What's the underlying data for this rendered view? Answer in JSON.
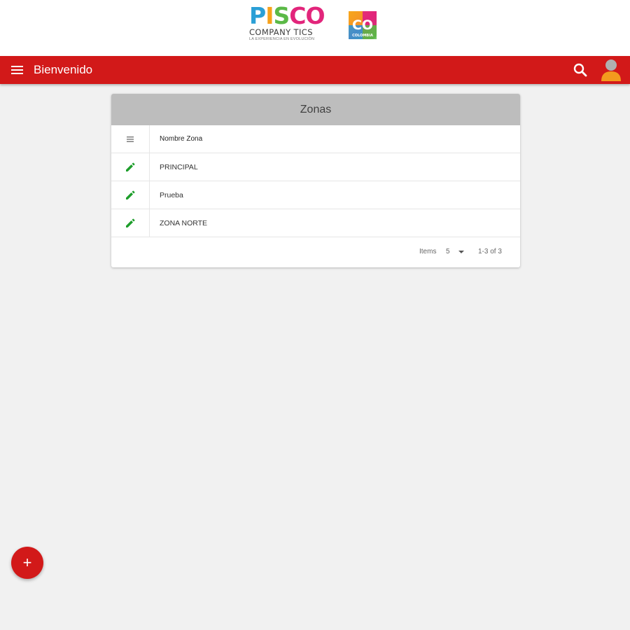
{
  "brand": {
    "logo_text_letters": [
      "P",
      "I",
      "S",
      "C",
      "O"
    ],
    "logo_subtitle": "COMPANY TICS",
    "logo_tagline": "LA EXPERIENCIA EN EVOLUCIÓN",
    "badge_text": "CO",
    "badge_caption": "COLOMBIA"
  },
  "appbar": {
    "title": "Bienvenido",
    "color": "#d21919",
    "icons": [
      "menu-icon",
      "search-icon",
      "user-avatar-icon"
    ]
  },
  "table": {
    "title": "Zonas",
    "column_header": "Nombre Zona",
    "rows": [
      {
        "name": "PRINCIPAL"
      },
      {
        "name": "Prueba"
      },
      {
        "name": "ZONA NORTE"
      }
    ],
    "footer": {
      "items_label": "Items",
      "items_per_page": "5",
      "range": "1-3 of 3"
    }
  },
  "fab": {
    "label": "+"
  },
  "colors": {
    "accent": "#d21919",
    "edit_icon": "#1e9e2c",
    "header_bg": "#bdbdbd",
    "page_bg": "#f1f1f1"
  }
}
